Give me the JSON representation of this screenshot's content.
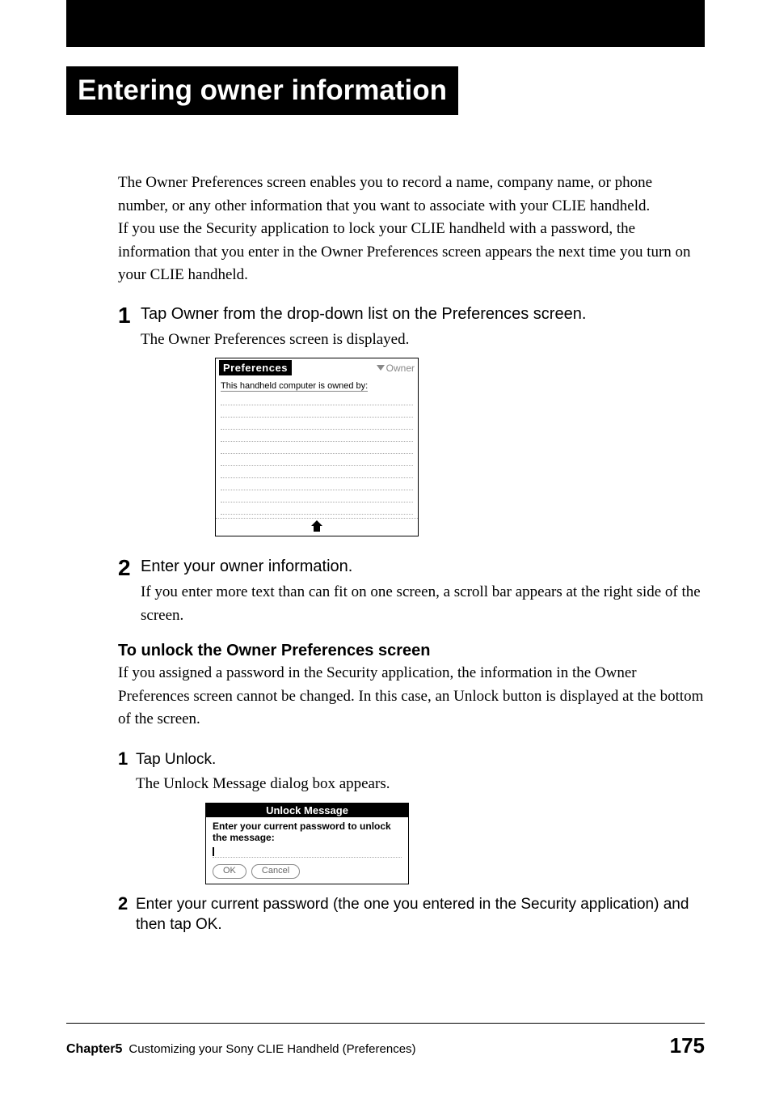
{
  "heading": "Entering owner information",
  "intro1": "The Owner Preferences screen enables you to record a name, company name, or phone number, or any other information that you want to associate with your CLIE handheld.",
  "intro2": "If you use the Security application to lock your CLIE handheld with a password, the information that you enter in the Owner Preferences screen appears the next time you turn on your CLIE handheld.",
  "steps": {
    "s1": {
      "num": "1",
      "instruction": "Tap Owner from the drop-down list on the Preferences screen.",
      "caption": "The Owner Preferences screen is displayed."
    },
    "s2": {
      "num": "2",
      "instruction": "Enter your owner information.",
      "caption": "If you enter more text than can fit on one screen, a scroll bar appears at the right side of the screen."
    }
  },
  "prefs": {
    "title": "Preferences",
    "dropdown": "Owner",
    "prompt": "This handheld computer is owned by:"
  },
  "subheading": "To unlock the Owner Preferences screen",
  "unlock_para": "If you assigned a password in the Security application, the information in the Owner Preferences screen cannot be changed. In this case, an Unlock button is displayed at the bottom of the screen.",
  "unlock_steps": {
    "u1": {
      "num": "1",
      "instruction": "Tap Unlock.",
      "caption": "The Unlock Message dialog box appears."
    },
    "u2": {
      "num": "2",
      "instruction": "Enter your current password (the one you entered in the Security application) and then tap OK."
    }
  },
  "dialog": {
    "title": "Unlock Message",
    "prompt": "Enter your current password to unlock the message:",
    "ok": "OK",
    "cancel": "Cancel"
  },
  "footer": {
    "chapter": "Chapter5",
    "title": "Customizing your Sony CLIE Handheld (Preferences)",
    "page": "175"
  }
}
